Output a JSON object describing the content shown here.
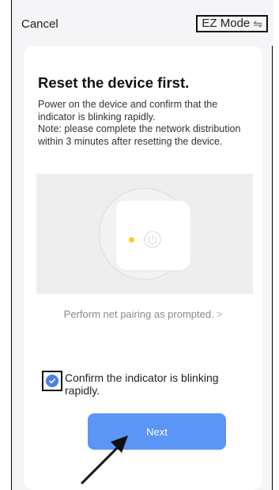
{
  "header": {
    "cancel_label": "Cancel",
    "mode_label": "EZ Mode",
    "mode_icon": "swap-icon"
  },
  "card": {
    "title": "Reset the device first.",
    "description": "Power on the device and confirm that the indicator is blinking rapidly.\nNote: please complete the network distribution within 3 minutes after resetting the device.",
    "pairing_link": "Perform net pairing as prompted.",
    "pairing_chevron": ">",
    "confirm_label": "Confirm the indicator is blinking rapidly.",
    "confirm_checked": true,
    "next_label": "Next"
  },
  "colors": {
    "accent": "#5b95f5",
    "checkbox": "#4a80e8",
    "indicator_led": "#f5cf2a"
  }
}
